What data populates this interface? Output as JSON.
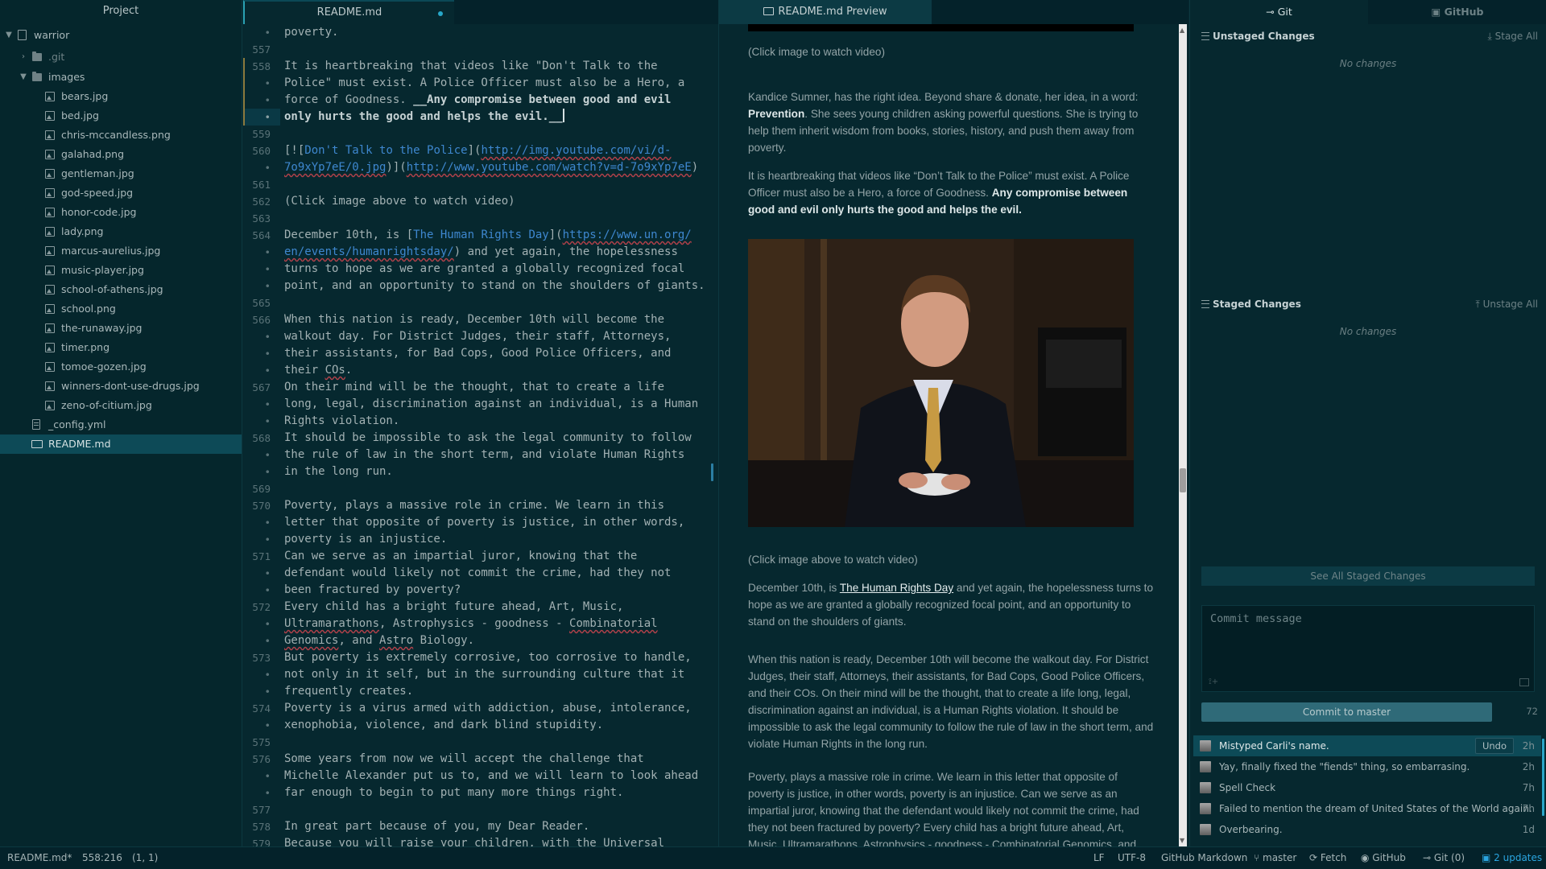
{
  "tree": {
    "title": "Project",
    "root": "warrior",
    "git_folder": ".git",
    "images_folder": "images",
    "files": [
      "bears.jpg",
      "bed.jpg",
      "chris-mccandless.png",
      "galahad.png",
      "gentleman.jpg",
      "god-speed.jpg",
      "honor-code.jpg",
      "lady.png",
      "marcus-aurelius.jpg",
      "music-player.jpg",
      "school-of-athens.jpg",
      "school.png",
      "the-runaway.jpg",
      "timer.png",
      "tomoe-gozen.jpg",
      "winners-dont-use-drugs.jpg",
      "zeno-of-citium.jpg"
    ],
    "config": "_config.yml",
    "readme": "README.md"
  },
  "editor": {
    "tab": "README.md",
    "lines": [
      {
        "n": "•",
        "t": "poverty."
      },
      {
        "n": "557",
        "t": ""
      },
      {
        "n": "558",
        "t": "It is heartbreaking that videos like \"Don't Talk to the"
      },
      {
        "n": "•",
        "t": "Police\" must exist. A Police Officer must also be a Hero, a"
      },
      {
        "n": "•",
        "t": "force of Goodness. __Any compromise between good and evil"
      },
      {
        "n": "•",
        "t": "only hurts the good and helps the evil.__"
      },
      {
        "n": "559",
        "t": ""
      },
      {
        "n": "560",
        "t": "[![Don't Talk to the Police](http://img.youtube.com/vi/d-"
      },
      {
        "n": "•",
        "t": "7o9xYp7eE/0.jpg)](http://www.youtube.com/watch?v=d-7o9xYp7eE)"
      },
      {
        "n": "561",
        "t": ""
      },
      {
        "n": "562",
        "t": "(Click image above to watch video)"
      },
      {
        "n": "563",
        "t": ""
      },
      {
        "n": "564",
        "t": "December 10th, is [The Human Rights Day](https://www.un.org/"
      },
      {
        "n": "•",
        "t": "en/events/humanrightsday/) and yet again, the hopelessness"
      },
      {
        "n": "•",
        "t": "turns to hope as we are granted a globally recognized focal"
      },
      {
        "n": "•",
        "t": "point, and an opportunity to stand on the shoulders of giants."
      },
      {
        "n": "565",
        "t": ""
      },
      {
        "n": "566",
        "t": "When this nation is ready, December 10th will become the"
      },
      {
        "n": "•",
        "t": "walkout day. For District Judges, their staff, Attorneys,"
      },
      {
        "n": "•",
        "t": "their assistants, for Bad Cops, Good Police Officers, and"
      },
      {
        "n": "•",
        "t": "their COs."
      },
      {
        "n": "567",
        "t": "On their mind will be the thought, that to create a life"
      },
      {
        "n": "•",
        "t": "long, legal, discrimination against an individual, is a Human"
      },
      {
        "n": "•",
        "t": "Rights violation."
      },
      {
        "n": "568",
        "t": "It should be impossible to ask the legal community to follow"
      },
      {
        "n": "•",
        "t": "the rule of law in the short term, and violate Human Rights"
      },
      {
        "n": "•",
        "t": "in the long run."
      },
      {
        "n": "569",
        "t": ""
      },
      {
        "n": "570",
        "t": "Poverty, plays a massive role in crime. We learn in this"
      },
      {
        "n": "•",
        "t": "letter that opposite of poverty is justice, in other words,"
      },
      {
        "n": "•",
        "t": "poverty is an injustice."
      },
      {
        "n": "571",
        "t": "Can we serve as an impartial juror, knowing that the"
      },
      {
        "n": "•",
        "t": "defendant would likely not commit the crime, had they not"
      },
      {
        "n": "•",
        "t": "been fractured by poverty?"
      },
      {
        "n": "572",
        "t": "Every child has a bright future ahead, Art, Music,"
      },
      {
        "n": "•",
        "t": "Ultramarathons, Astrophysics - goodness - Combinatorial"
      },
      {
        "n": "•",
        "t": "Genomics, and Astro Biology."
      },
      {
        "n": "573",
        "t": "But poverty is extremely corrosive, too corrosive to handle,"
      },
      {
        "n": "•",
        "t": "not only in it self, but in the surrounding culture that it"
      },
      {
        "n": "•",
        "t": "frequently creates."
      },
      {
        "n": "574",
        "t": "Poverty is a virus armed with addiction, abuse, intolerance,"
      },
      {
        "n": "•",
        "t": "xenophobia, violence, and dark blind stupidity."
      },
      {
        "n": "575",
        "t": ""
      },
      {
        "n": "576",
        "t": "Some years from now we will accept the challenge that"
      },
      {
        "n": "•",
        "t": "Michelle Alexander put us to, and we will learn to look ahead"
      },
      {
        "n": "•",
        "t": "far enough to begin to put many more things right."
      },
      {
        "n": "577",
        "t": ""
      },
      {
        "n": "578",
        "t": "In great part because of you, my Dear Reader."
      },
      {
        "n": "579",
        "t": "Because you will raise your children, with the Universal"
      }
    ]
  },
  "preview": {
    "tab": "README.md Preview",
    "p1": "(Click image to watch video)",
    "p2_a": "Kandice Sumner, has the right idea. Beyond share & donate, her idea, in a word: ",
    "p2_b": "Prevention",
    "p2_c": ". She sees young children asking powerful questions. She is trying to help them inherit wisdom from books, stories, history, and push them away from poverty.",
    "p3_a": "It is heartbreaking that videos like “Don’t Talk to the Police” must exist. A Police Officer must also be a Hero, a force of Goodness. ",
    "p3_b": "Any compromise between good and evil only hurts the good and helps the evil.",
    "p4": "(Click image above to watch video)",
    "p5_a": "December 10th, is ",
    "p5_link": "The Human Rights Day",
    "p5_c": " and yet again, the hopelessness turns to hope as we are granted a globally recognized focal point, and an opportunity to stand on the shoulders of giants.",
    "p6": "When this nation is ready, December 10th will become the walkout day. For District Judges, their staff, Attorneys, their assistants, for Bad Cops, Good Police Officers, and their COs. On their mind will be the thought, that to create a life long, legal, discrimination against an individual, is a Human Rights violation. It should be impossible to ask the legal community to follow the rule of law in the short term, and violate Human Rights in the long run.",
    "p7": "Poverty, plays a massive role in crime. We learn in this letter that opposite of poverty is justice, in other words, poverty is an injustice. Can we serve as an impartial juror, knowing that the defendant would likely not commit the crime, had they not been fractured by poverty? Every child has a bright future ahead, Art, Music, Ultramarathons, Astrophysics - goodness - Combinatorial Genomics, and"
  },
  "git": {
    "tab_git": "Git",
    "tab_github": "GitHub",
    "unstaged_title": "Unstaged Changes",
    "stage_all": "Stage All",
    "unstaged_empty": "No changes",
    "staged_title": "Staged Changes",
    "unstage_all": "Unstage All",
    "staged_empty": "No changes",
    "see_all": "See All Staged Changes",
    "commit_placeholder": "Commit message",
    "commit_button": "Commit to master",
    "char_count": "72",
    "undo": "Undo",
    "commits": [
      {
        "msg": "Mistyped Carli's name.",
        "age": "2h"
      },
      {
        "msg": "Yay, finally fixed the \"fiends\" thing, so embarrasing.",
        "age": "2h"
      },
      {
        "msg": "Spell Check",
        "age": "7h"
      },
      {
        "msg": "Failed to mention the dream of United States of the World again.",
        "age": "7h"
      },
      {
        "msg": "Overbearing.",
        "age": "1d"
      }
    ]
  },
  "status": {
    "file": "README.md*",
    "cursor": "558:216",
    "selection": "(1, 1)",
    "eol": "LF",
    "encoding": "UTF-8",
    "grammar": "GitHub Markdown",
    "branch": "master",
    "fetch": "Fetch",
    "github": "GitHub",
    "git": "Git (0)",
    "updates": "2 updates"
  },
  "colors": {
    "accent": "#2aa5e0",
    "background": "#06282f",
    "selection": "#0d4a57"
  }
}
